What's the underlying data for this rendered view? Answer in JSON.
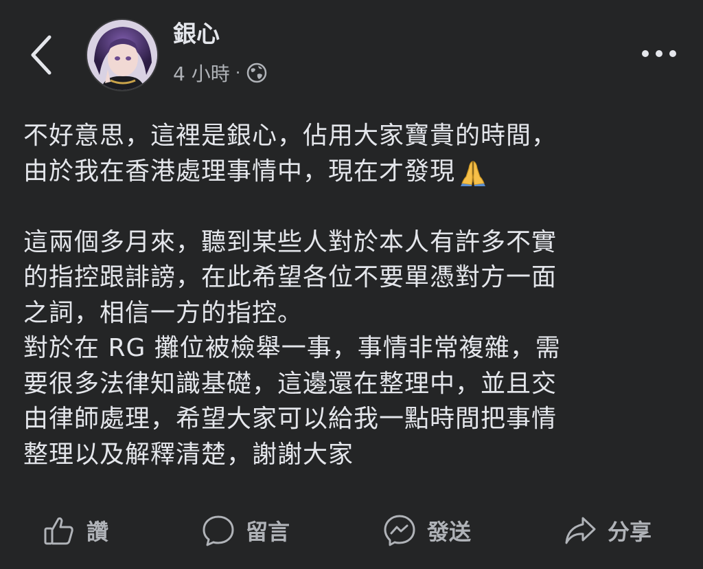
{
  "header": {
    "author_name": "銀心",
    "time_label": "4 小時",
    "separator": "·",
    "icons": {
      "back": "chevron-left-icon",
      "privacy": "globe-icon",
      "more": "more-horizontal-icon"
    }
  },
  "post": {
    "lines_paragraph1": [
      "不好意思，這裡是銀心，佔用大家寶貴的時間，",
      "由於我在香港處理事情中，現在才發現"
    ],
    "emoji": "folded-hands-emoji",
    "lines_paragraph2": [
      "這兩個多月來，聽到某些人對於本人有許多不實",
      "的指控跟誹謗，在此希望各位不要單憑對方一面",
      "之詞，相信一方的指控。",
      "對於在 RG 攤位被檢舉一事，事情非常複雜，需",
      "要很多法律知識基礎，這邊還在整理中，並且交",
      "由律師處理，希望大家可以給我一點時間把事情",
      "整理以及解釋清楚，謝謝大家"
    ]
  },
  "actions": {
    "like": "讚",
    "comment": "留言",
    "send": "發送",
    "share": "分享"
  },
  "colors": {
    "background": "#242526",
    "primary_text": "#e4e6eb",
    "secondary_text": "#b0b3b8"
  }
}
